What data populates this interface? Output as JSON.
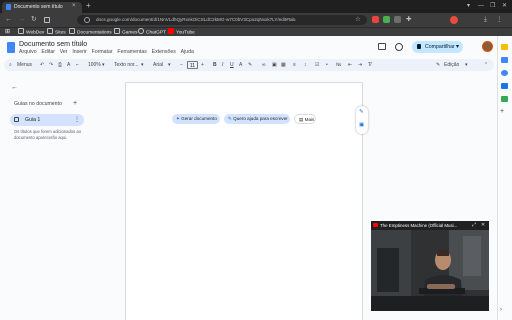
{
  "browser": {
    "tab_title": "Documento sem título",
    "tab_close": "×",
    "new_tab": "+",
    "url": "docs.google.com/document/d/1NnVLdhQyRxnkOiCSLdC2kMG-w7C0bV3Cpo2qNxxk7LY/edit#tab=t.0",
    "window_controls": [
      "▾",
      "—",
      "❐",
      "✕"
    ],
    "nav": {
      "back": "←",
      "forward": "→",
      "reload": "↻"
    },
    "bookmarks": [
      "WebDev",
      "Sites",
      "Documentations",
      "Games",
      "ChatGPT",
      "YouTube"
    ]
  },
  "docs": {
    "title": "Documento sem título",
    "star": "☆",
    "menu": [
      "Arquivo",
      "Editar",
      "Ver",
      "Inserir",
      "Formatar",
      "Ferramentas",
      "Extensões",
      "Ajuda"
    ],
    "share_label": "Compartilhar",
    "toolbar": {
      "search": "Menus",
      "zoom": "100%",
      "style": "Texto nor...",
      "font": "Arial",
      "size": "11",
      "mode": "Edição"
    }
  },
  "outline": {
    "back": "←",
    "title": "Guias no documento",
    "add": "+",
    "tab_label": "Guia 1",
    "more": "⋮",
    "hint": "Os títulos que forem adicionados ao documento aparecerão aqui."
  },
  "page": {
    "chips": [
      "Gerar documento",
      "Quero ajuda para escrever",
      "Mais"
    ]
  },
  "pip": {
    "title": "The Emptiness Machine (Official Musi...",
    "controls": [
      "⤢",
      "✕"
    ]
  },
  "colors": {
    "accent": "#c2e7ff",
    "chip": "#d3e3fd",
    "docs_blue": "#4285f4",
    "youtube_red": "#ff0000"
  }
}
